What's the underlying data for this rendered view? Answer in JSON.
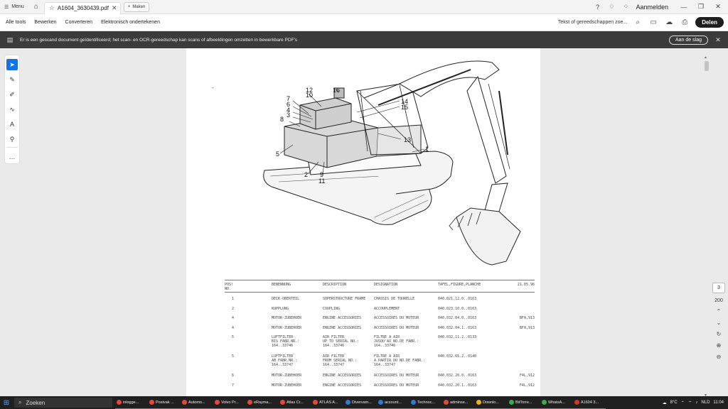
{
  "tabbar": {
    "menu_label": "Menu",
    "tab_title": "A1604_3630439.pdf",
    "new_tab_label": "Maken",
    "signin_label": "Aanmelden"
  },
  "menubar": {
    "items": [
      "Alle tools",
      "Bewerken",
      "Converteren",
      "Elektronisch ondertekenen"
    ],
    "search_placeholder": "Tekst of gereedschappen zoe...",
    "share_label": "Delen"
  },
  "banner": {
    "message": "Er is een gescand document geïdentificeerd; het scan- en OCR-gereedschap kan scans of afbeeldingen omzetten in bewerkbare PDF's",
    "action_label": "Aan de slag"
  },
  "viewer": {
    "current_page": "3",
    "total_pages": "200"
  },
  "drawing": {
    "callouts": [
      "12",
      "10",
      "16",
      "7",
      "6",
      "4",
      "3",
      "8",
      "14",
      "15",
      "13",
      "1",
      "5",
      "2",
      "9",
      "11"
    ]
  },
  "parts_table": {
    "headers": {
      "pos": "POS!\nNO.",
      "benennung": "BENENNUNG",
      "description": "DESCRIPTION",
      "designation": "DESIGNATION",
      "tafel": "TAFEL,FIGURE,PLANCHE",
      "date": "21.05.96"
    },
    "rows": [
      {
        "pos": "1",
        "ben": "DECK-OBERTEIL",
        "des": "SUPERSTRUCTURE FRAME",
        "dsg": "CHASSIS DE TOURELLE",
        "tab": "040.021.12.0..0163",
        "rem": ""
      },
      {
        "pos": "2",
        "ben": "KUPPLUNG",
        "des": "COUPLING",
        "dsg": "ACCOUPLEMENT",
        "tab": "040.023.10.0..0163",
        "rem": ""
      },
      {
        "pos": "4",
        "ben": "MOTOR-ZUBEHOER",
        "des": "ENGINE ACCESSORIES",
        "dsg": "ACCESSOIRES DU MOTEUR",
        "tab": "040.032.04.0..0163",
        "rem": "BFA,913"
      },
      {
        "pos": "4",
        "ben": "MOTOR-ZUBEHOER",
        "des": "ENGINE ACCESSORIES",
        "dsg": "ACCESSOIRES DU MOTEUR",
        "tab": "040.032.04.1..0163",
        "rem": "BFA,913"
      },
      {
        "pos": "5",
        "ben": "LUFTFILTER\nBIS FABR.NR.:\n164..33746",
        "des": "AIR FILTER\nUP TO SERIAL NO.:\n164..33746",
        "dsg": "FILTRE A AIR\nJUSQU'AU NO.DE FABR.:\n164..33746",
        "tab": "040.032.11.2..0133",
        "rem": ""
      },
      {
        "pos": "5",
        "ben": "LUFTFILTER\nAB FABR.NR.:\n164..33747",
        "des": "AIR FILTER\nFROM SERIAL NO.:\n164..33747",
        "dsg": "FILTRE A AIR\nA PARTIR DU NO.DE FABR.:\n164..33747",
        "tab": "040.032.65.2..0140",
        "rem": ""
      },
      {
        "pos": "6",
        "ben": "MOTOR-ZUBEHOER",
        "des": "ENGINE ACCESSORIES",
        "dsg": "ACCESSOIRES DU MOTEUR",
        "tab": "040.032.20.0..0163",
        "rem": "F4L,912"
      },
      {
        "pos": "7",
        "ben": "MOTOR-ZUBEHOER",
        "des": "ENGINE ACCESSORIES",
        "dsg": "ACCESSOIRES DU MOTEUR",
        "tab": "040.032.20.1..0163",
        "rem": "F4L,912"
      }
    ]
  },
  "taskbar": {
    "search_label": "Zoeken",
    "apps": [
      {
        "label": "inlogge...",
        "color": "#e8453c"
      },
      {
        "label": "Postvak ...",
        "color": "#e8453c"
      },
      {
        "label": "Automo...",
        "color": "#e8453c"
      },
      {
        "label": "Volvo Pr...",
        "color": "#e8453c"
      },
      {
        "label": "eRayma...",
        "color": "#e8453c"
      },
      {
        "label": "Atlas Cr...",
        "color": "#e8453c"
      },
      {
        "label": "ATLAS A...",
        "color": "#e8453c"
      },
      {
        "label": "Divervam...",
        "color": "#2b7cd3"
      },
      {
        "label": "account...",
        "color": "#2b7cd3"
      },
      {
        "label": "Technoc...",
        "color": "#2b7cd3"
      },
      {
        "label": "adminse...",
        "color": "#e8453c"
      },
      {
        "label": "Downlo...",
        "color": "#f2b01e"
      },
      {
        "label": "BitTorre...",
        "color": "#3ea84d"
      },
      {
        "label": "WhatsA...",
        "color": "#3ea84d"
      },
      {
        "label": "A1604 3...",
        "color": "#d9332d"
      }
    ],
    "temperature": "8°C",
    "language": "NLD",
    "time": "11:04"
  }
}
